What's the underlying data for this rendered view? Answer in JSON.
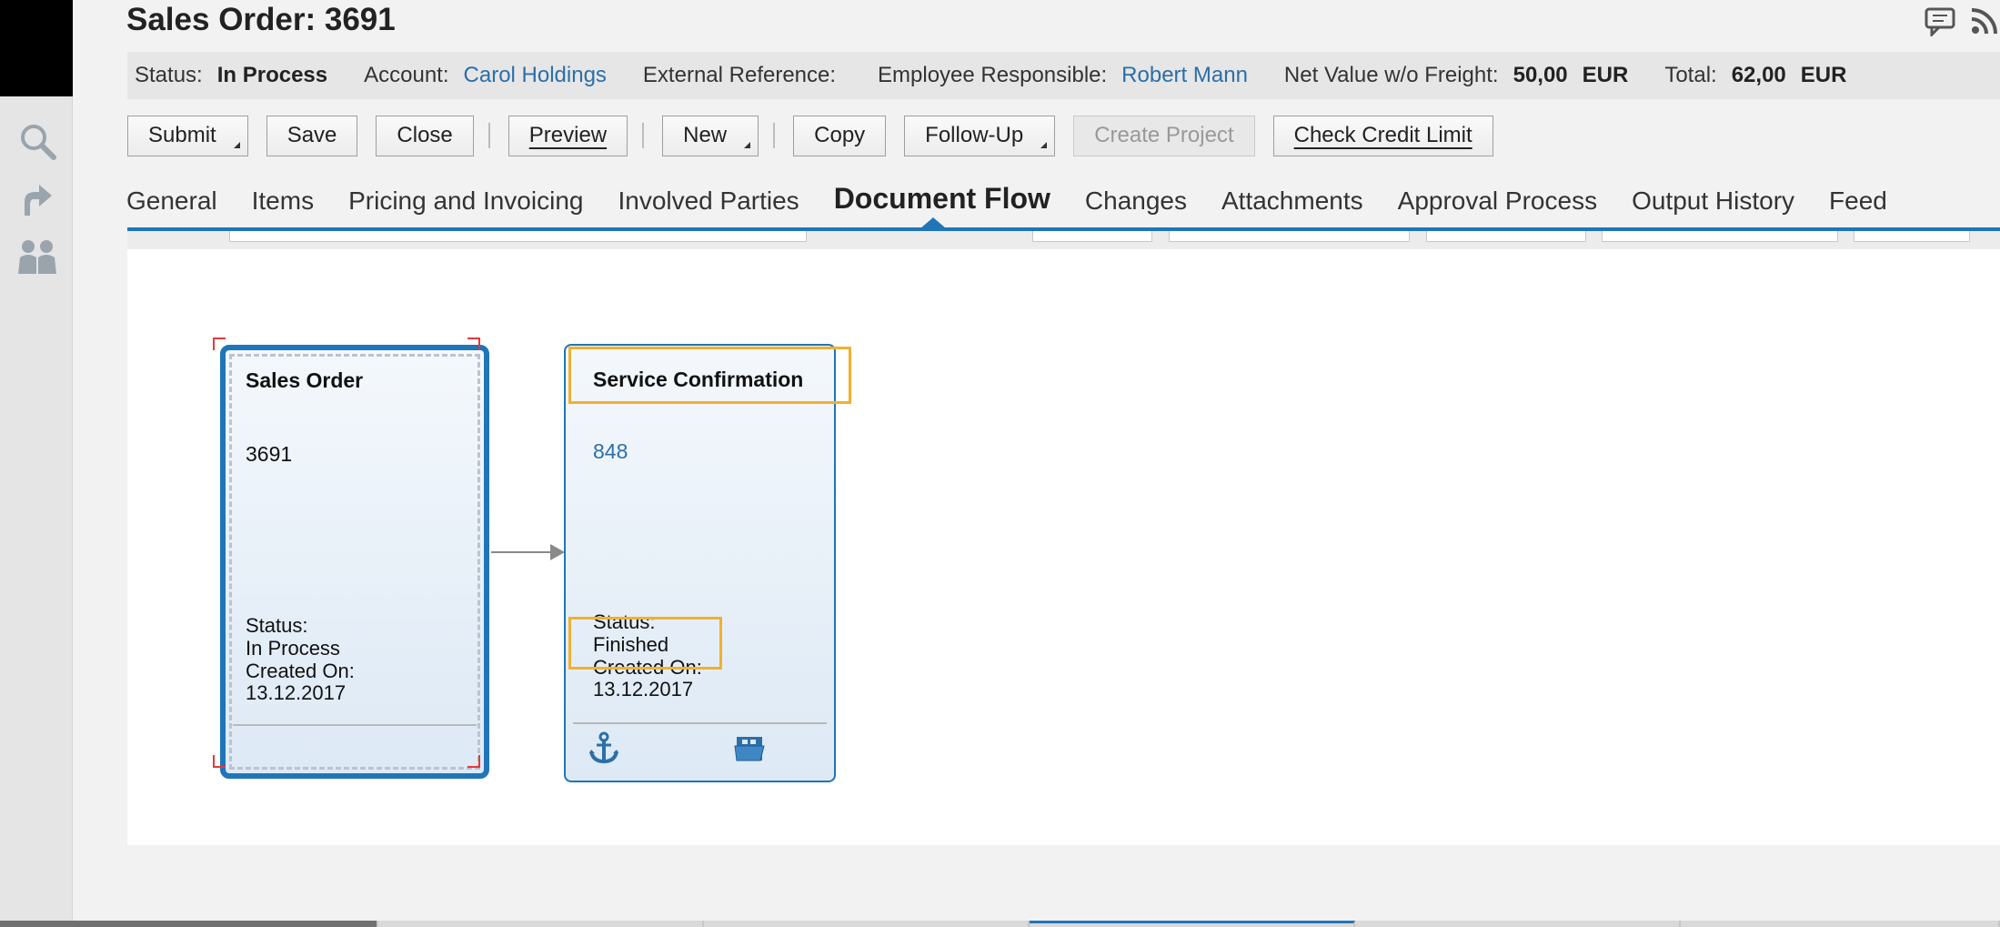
{
  "header": {
    "title": "Sales Order: 3691"
  },
  "status_bar": {
    "status_label": "Status:",
    "status_value": "In Process",
    "account_label": "Account:",
    "account_value": "Carol Holdings",
    "external_reference_label": "External Reference:",
    "employee_label": "Employee Responsible:",
    "employee_value": "Robert Mann",
    "net_value_label": "Net Value w/o Freight:",
    "net_value": "50,00",
    "net_currency": "EUR",
    "total_label": "Total:",
    "total_value": "62,00",
    "total_currency": "EUR"
  },
  "toolbar": {
    "submit": "Submit",
    "save": "Save",
    "close": "Close",
    "preview": "Preview",
    "new": "New",
    "copy": "Copy",
    "follow_up": "Follow-Up",
    "create_project": "Create Project",
    "check_credit_limit": "Check Credit Limit"
  },
  "tabs": {
    "general": "General",
    "items": "Items",
    "pricing": "Pricing and Invoicing",
    "involved_parties": "Involved Parties",
    "document_flow": "Document Flow",
    "changes": "Changes",
    "attachments": "Attachments",
    "approval_process": "Approval Process",
    "output_history": "Output History",
    "feed": "Feed"
  },
  "flow": {
    "sales_order": {
      "title": "Sales Order",
      "number": "3691",
      "status_label": "Status:",
      "status_value": "In Process",
      "created_label": "Created On:",
      "created_value": "13.12.2017"
    },
    "service_confirmation": {
      "title": "Service Confirmation",
      "number": "848",
      "status_label": "Status:",
      "status_value": "Finished",
      "created_label": "Created On:",
      "created_value": "13.12.2017"
    }
  },
  "colors": {
    "accent": "#1f75b8",
    "link": "#2b6fa8",
    "highlight": "#f0b030"
  },
  "icons": {
    "rail": [
      "search-icon",
      "follow-arrow-icon",
      "people-icon"
    ],
    "top": [
      "feedback-icon",
      "rss-icon"
    ],
    "card_footer": [
      "anchor-icon",
      "open-folder-icon"
    ]
  }
}
